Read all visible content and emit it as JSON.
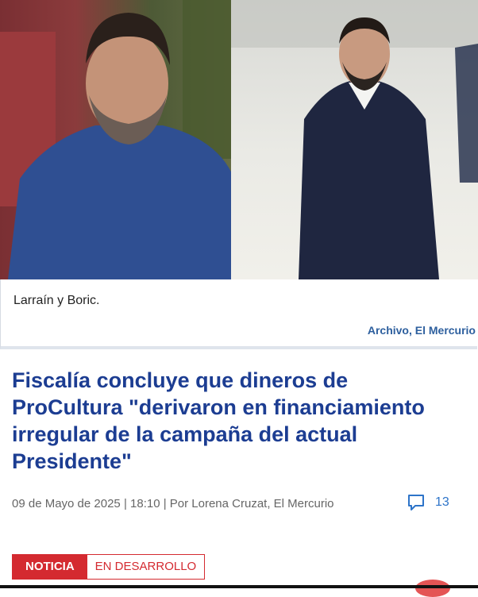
{
  "photos": {
    "left": {
      "subject": "man in blue shirt"
    },
    "right": {
      "subject": "man in dark suit"
    }
  },
  "caption": {
    "text": "Larraín y Boric.",
    "credit": "Archivo, El Mercurio"
  },
  "article": {
    "headline": "Fiscalía concluye que dineros de ProCultura \"derivaron en financiamiento irregular de la campaña del actual Presidente\"",
    "meta": "09 de Mayo de 2025 | 18:10 | Por Lorena Cruzat, El Mercurio",
    "comment_count": "13"
  },
  "badges": {
    "primary": "NOTICIA",
    "secondary": "EN DESARROLLO"
  },
  "colors": {
    "headline": "#1c3d92",
    "credit": "#2d5f9e",
    "badge_red": "#d42a30",
    "comment_blue": "#2d74c9"
  },
  "icons": {
    "comment": "speech-bubble-icon"
  }
}
